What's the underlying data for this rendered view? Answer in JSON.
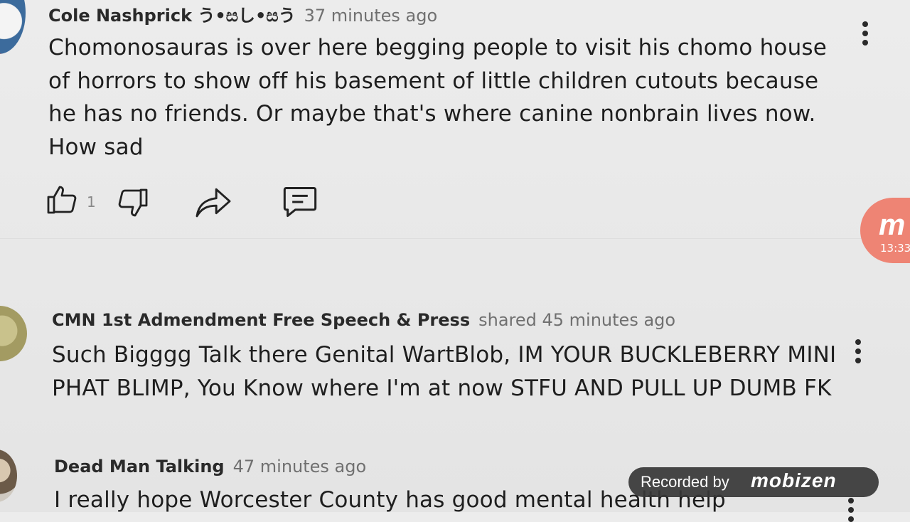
{
  "comments": [
    {
      "author": "Cole Nashprick う•සし•සう",
      "time": "37 minutes ago",
      "lines": [
        "Chomonosauras is over here begging people to visit his chomo house",
        "of horrors to show off his basement of little children cutouts because",
        "he has no friends. Or maybe that's where canine nonbrain lives now.",
        "How sad"
      ],
      "like_count": "1"
    },
    {
      "author": "CMN 1st Admendment Free Speech & Press",
      "time": "shared 45 minutes ago",
      "lines": [
        "Such Bigggg Talk there Genital WartBlob, IM YOUR BUCKLEBERRY MINI",
        "PHAT BLIMP, You Know where I'm at now STFU AND PULL UP DUMB FK"
      ]
    },
    {
      "author": "Dead Man Talking",
      "time": "47 minutes ago",
      "lines": [
        "I really hope Worcester County has good mental health help"
      ]
    }
  ],
  "icons": {
    "like": "thumbs-up-icon",
    "dislike": "thumbs-down-icon",
    "share": "share-icon",
    "reply": "reply-icon",
    "more": "more-vert-icon"
  },
  "overlay": {
    "bubble_letter": "m",
    "bubble_time": "13:33",
    "recorded_label": "Recorded by",
    "recorded_brand": "mobizen"
  },
  "colors": {
    "background": "#e9e9e9",
    "bubble": "#ee8474",
    "recorded_bg": "#373737"
  }
}
